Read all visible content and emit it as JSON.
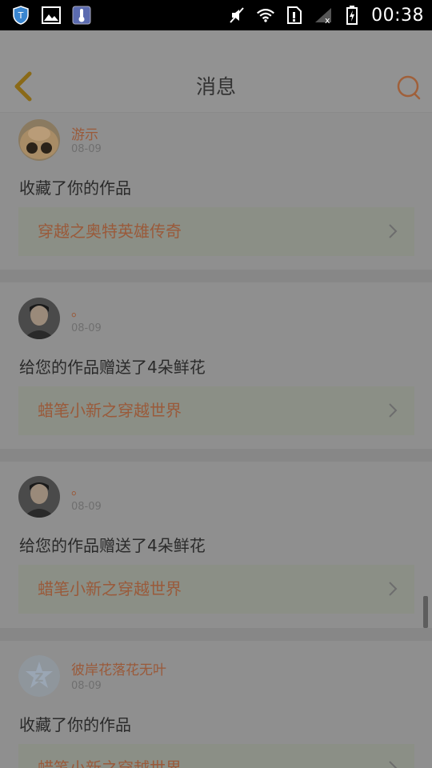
{
  "status_bar": {
    "time": "00:38",
    "left_icons": [
      "shield-icon",
      "image-icon",
      "thermometer-icon"
    ],
    "right_icons": [
      "mute-icon",
      "wifi-icon",
      "sim-icon",
      "signal-icon",
      "battery-charging-icon"
    ]
  },
  "header": {
    "title": "消息",
    "back_icon": "chevron-left-icon",
    "search_icon": "search-icon",
    "accent_color": "#9a7a1e",
    "search_color": "#a0603a"
  },
  "notifications": [
    {
      "username": "游示",
      "date": "08-09",
      "message": "收藏了你的作品",
      "work_title": "穿越之奥特英雄传奇",
      "avatar": "hamster-avatar"
    },
    {
      "username": "。",
      "date": "08-09",
      "message": "给您的作品赠送了4朵鲜花",
      "work_title": "蜡笔小新之穿越世界",
      "avatar": "man-avatar"
    },
    {
      "username": "。",
      "date": "08-09",
      "message": "给您的作品赠送了4朵鲜花",
      "work_title": "蜡笔小新之穿越世界",
      "avatar": "man-avatar"
    },
    {
      "username": "彼岸花落花无叶",
      "date": "08-09",
      "message": "收藏了你的作品",
      "work_title": "蜡笔小新之穿越世界",
      "avatar": "default-z-avatar"
    }
  ]
}
